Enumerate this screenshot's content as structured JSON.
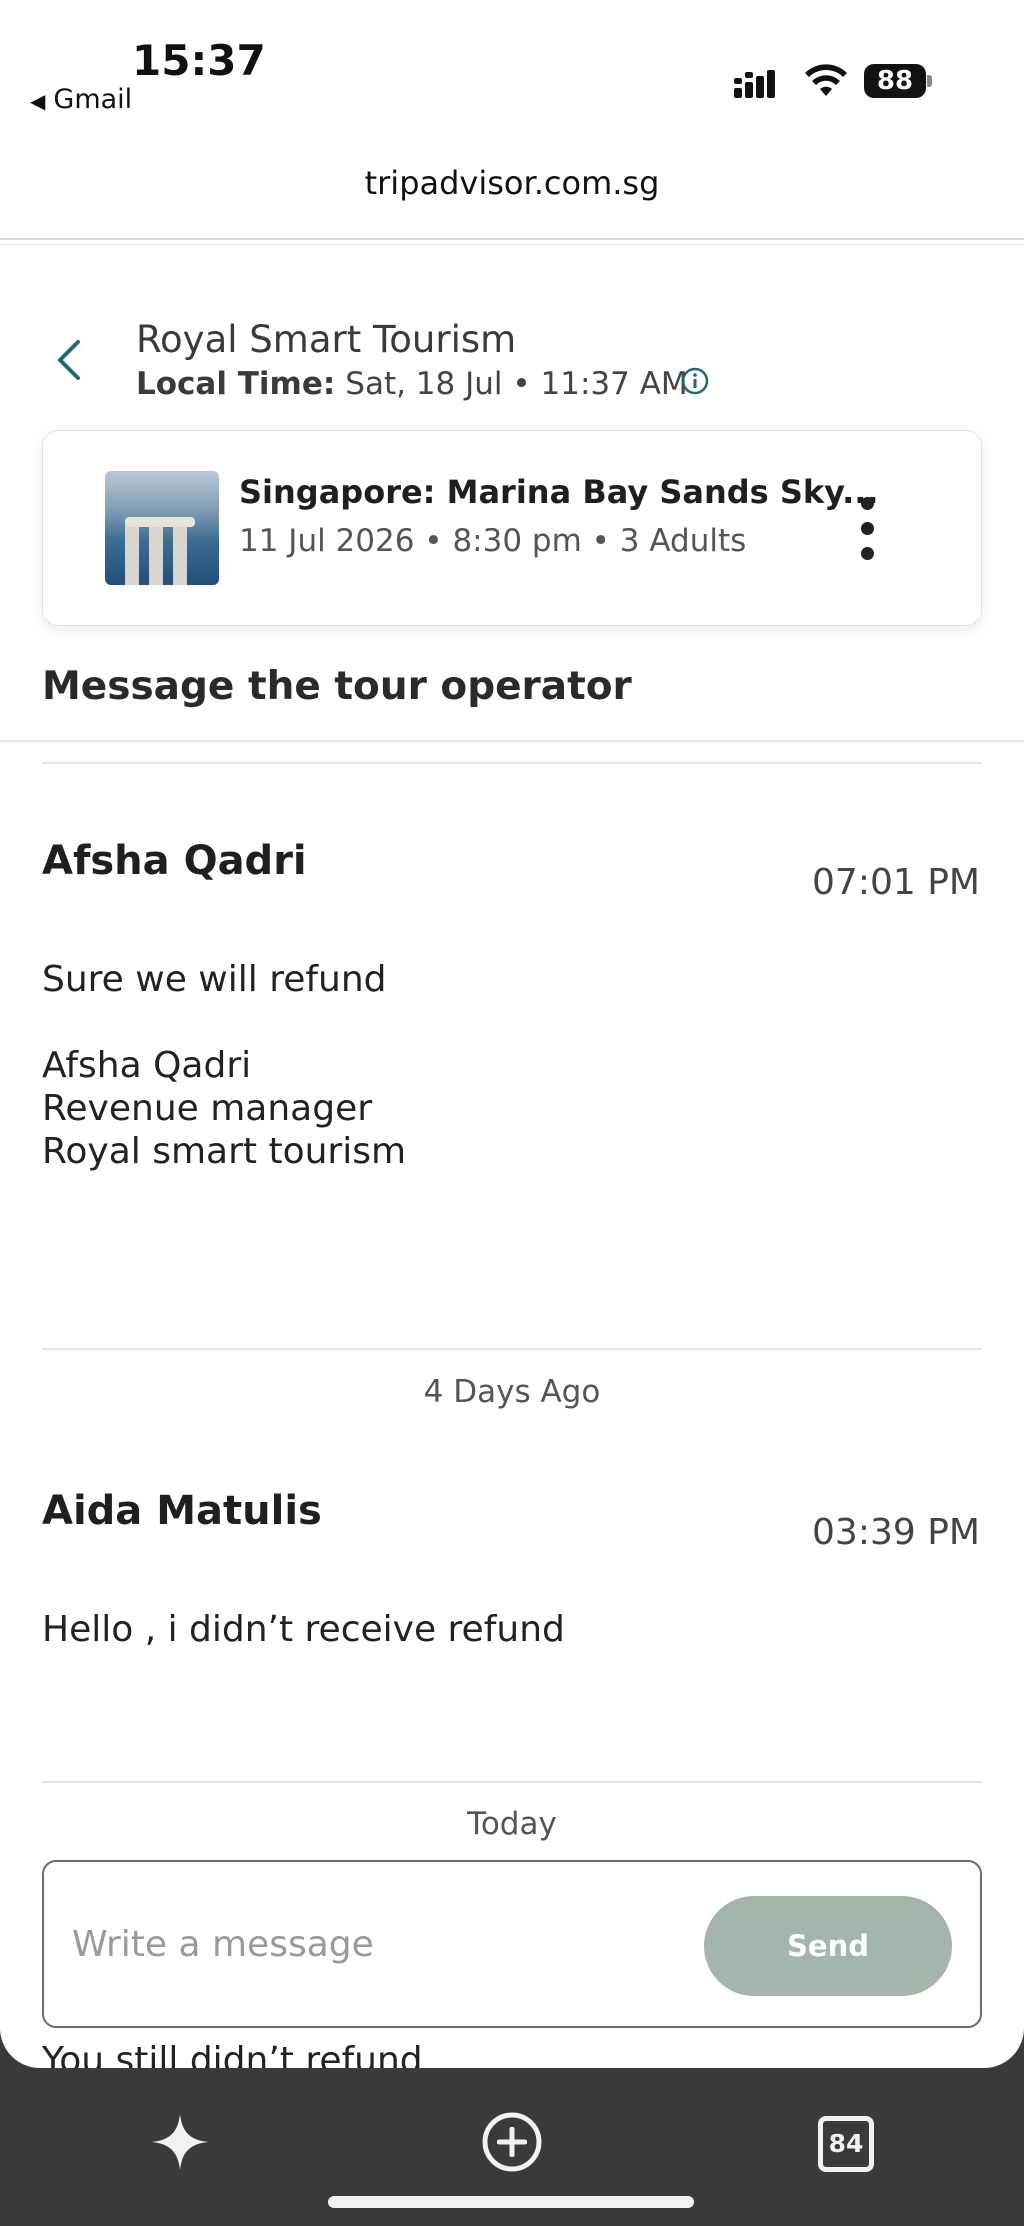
{
  "status_bar": {
    "time": "15:37",
    "back_app": "Gmail",
    "battery": "88",
    "icons": [
      "signal-icon",
      "wifi-icon",
      "battery-icon"
    ]
  },
  "browser": {
    "url": "tripadvisor.com.sg"
  },
  "header": {
    "operator_name": "Royal Smart Tourism",
    "local_time_label": "Local Time:",
    "local_time_value": "Sat, 18 Jul • 11:37 AM"
  },
  "booking_card": {
    "title": "Singapore: Marina Bay Sands Sky...",
    "details": "11 Jul 2026 • 8:30 pm • 3 Adults"
  },
  "section_title": "Message the tour operator",
  "messages": [
    {
      "sender": "Afsha Qadri",
      "time": "07:01 PM",
      "body": "Sure we will refund\n\nAfsha Qadri\nRevenue manager\nRoyal smart tourism"
    },
    {
      "separator": "4 Days Ago",
      "sender": "Aida Matulis",
      "time": "03:39 PM",
      "body": "Hello , i didn’t receive refund"
    },
    {
      "separator": "Today",
      "body": "You still didn’t refund"
    }
  ],
  "composer": {
    "placeholder": "Write a message",
    "value": "",
    "send_label": "Send"
  },
  "toolbar": {
    "tabs_count": "84",
    "icons": [
      "sparkle-icon",
      "new-tab-icon",
      "tabs-icon"
    ]
  },
  "colors": {
    "accent": "#1a6b73",
    "send_button": "#a5b5aa",
    "toolbar_bg": "#3a3a3c"
  }
}
